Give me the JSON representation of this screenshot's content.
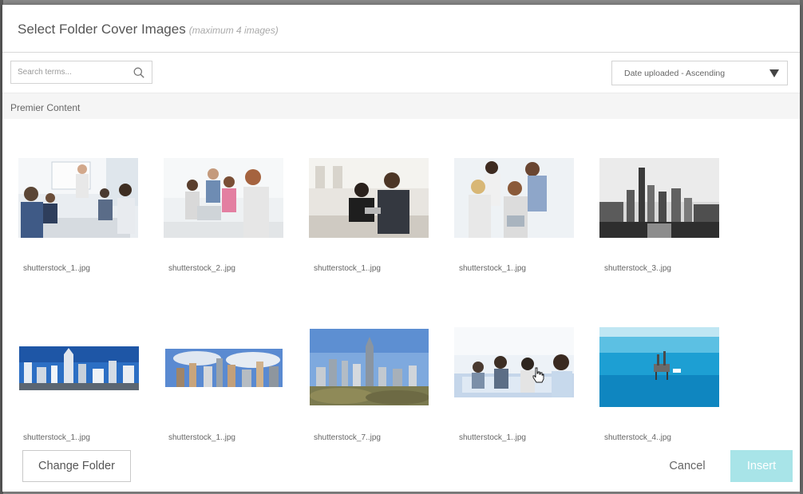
{
  "dialog": {
    "title": "Select Folder Cover Images",
    "subtitle": "(maximum 4 images)"
  },
  "search": {
    "placeholder": "Search terms...",
    "icon": "search-icon"
  },
  "sort": {
    "selected": "Date uploaded - Ascending",
    "icon": "caret-down-icon"
  },
  "section": {
    "label": "Premier Content"
  },
  "images": [
    {
      "caption": "shutterstock_1..jpg",
      "subject": "office meeting presentation"
    },
    {
      "caption": "shutterstock_2..jpg",
      "subject": "team around laptop"
    },
    {
      "caption": "shutterstock_1..jpg",
      "subject": "business couple with tablet"
    },
    {
      "caption": "shutterstock_1..jpg",
      "subject": "team with tablet"
    },
    {
      "caption": "shutterstock_3..jpg",
      "subject": "black and white city skyline"
    },
    {
      "caption": "shutterstock_1..jpg",
      "subject": "city skyline panorama"
    },
    {
      "caption": "shutterstock_1..jpg",
      "subject": "city skyline panorama"
    },
    {
      "caption": "shutterstock_7..jpg",
      "subject": "city skyline park"
    },
    {
      "caption": "shutterstock_1..jpg",
      "subject": "call center operators"
    },
    {
      "caption": "shutterstock_4..jpg",
      "subject": "offshore oil rig"
    }
  ],
  "footer": {
    "change_folder": "Change Folder",
    "cancel": "Cancel",
    "insert": "Insert"
  },
  "colors": {
    "insert_button": "#a8e4e8",
    "section_background": "#f5f5f5"
  }
}
